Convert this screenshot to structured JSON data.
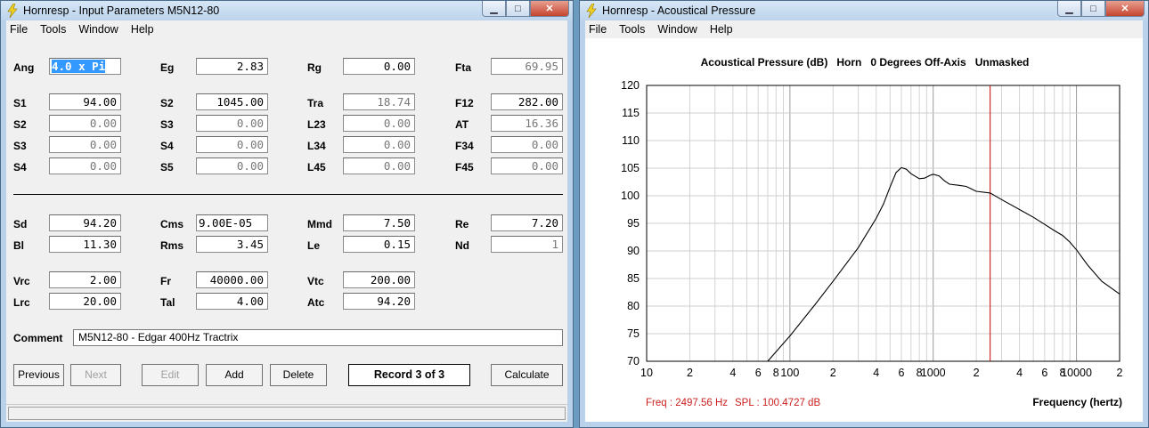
{
  "left_window": {
    "title": "Hornresp - Input Parameters   M5N12-80",
    "menu": [
      "File",
      "Tools",
      "Window",
      "Help"
    ],
    "fields": {
      "ang": {
        "label": "Ang",
        "value": "4.0 x Pi"
      },
      "eg": {
        "label": "Eg",
        "value": "2.83"
      },
      "rg": {
        "label": "Rg",
        "value": "0.00"
      },
      "fta": {
        "label": "Fta",
        "value": "69.95"
      },
      "s1": {
        "label": "S1",
        "value": "94.00"
      },
      "s2_top": {
        "label": "S2",
        "value": "1045.00"
      },
      "tra": {
        "label": "Tra",
        "value": "18.74"
      },
      "f12": {
        "label": "F12",
        "value": "282.00"
      },
      "s2": {
        "label": "S2",
        "value": "0.00"
      },
      "s3_mid": {
        "label": "S3",
        "value": "0.00"
      },
      "l23": {
        "label": "L23",
        "value": "0.00"
      },
      "at": {
        "label": "AT",
        "value": "16.36"
      },
      "s3": {
        "label": "S3",
        "value": "0.00"
      },
      "s4_mid": {
        "label": "S4",
        "value": "0.00"
      },
      "l34": {
        "label": "L34",
        "value": "0.00"
      },
      "f34": {
        "label": "F34",
        "value": "0.00"
      },
      "s4": {
        "label": "S4",
        "value": "0.00"
      },
      "s5": {
        "label": "S5",
        "value": "0.00"
      },
      "l45": {
        "label": "L45",
        "value": "0.00"
      },
      "f45": {
        "label": "F45",
        "value": "0.00"
      },
      "sd": {
        "label": "Sd",
        "value": "94.20"
      },
      "cms": {
        "label": "Cms",
        "value": "9.00E-05"
      },
      "mmd": {
        "label": "Mmd",
        "value": "7.50"
      },
      "re": {
        "label": "Re",
        "value": "7.20"
      },
      "bl": {
        "label": "Bl",
        "value": "11.30"
      },
      "rms": {
        "label": "Rms",
        "value": "3.45"
      },
      "le": {
        "label": "Le",
        "value": "0.15"
      },
      "nd": {
        "label": "Nd",
        "value": "1"
      },
      "vrc": {
        "label": "Vrc",
        "value": "2.00"
      },
      "fr": {
        "label": "Fr",
        "value": "40000.00"
      },
      "vtc": {
        "label": "Vtc",
        "value": "200.00"
      },
      "lrc": {
        "label": "Lrc",
        "value": "20.00"
      },
      "tal": {
        "label": "Tal",
        "value": "4.00"
      },
      "atc": {
        "label": "Atc",
        "value": "94.20"
      }
    },
    "comment_label": "Comment",
    "comment_value": "M5N12-80 - Edgar 400Hz Tractrix",
    "buttons": {
      "previous": "Previous",
      "next": "Next",
      "edit": "Edit",
      "add": "Add",
      "delete": "Delete",
      "calculate": "Calculate"
    },
    "record": "Record 3 of 3"
  },
  "right_window": {
    "title": "Hornresp - Acoustical Pressure",
    "menu": [
      "File",
      "Tools",
      "Window",
      "Help"
    ]
  },
  "chart_data": {
    "type": "line",
    "title": "Acoustical Pressure (dB)   Horn   0 Degrees Off-Axis   Unmasked",
    "xlabel": "Frequency (hertz)",
    "ylabel": "",
    "x_scale": "log",
    "xlim": [
      10,
      20000
    ],
    "ylim": [
      70,
      120
    ],
    "y_ticks": [
      "120",
      "115",
      "110",
      "105",
      "100",
      "95",
      "90",
      "85",
      "80",
      "75",
      "70"
    ],
    "x_tick_labels": [
      {
        "x": 10,
        "label": "10"
      },
      {
        "x": 20,
        "label": "2"
      },
      {
        "x": 40,
        "label": "4"
      },
      {
        "x": 60,
        "label": "6"
      },
      {
        "x": 80,
        "label": "8"
      },
      {
        "x": 100,
        "label": "100"
      },
      {
        "x": 200,
        "label": "2"
      },
      {
        "x": 400,
        "label": "4"
      },
      {
        "x": 600,
        "label": "6"
      },
      {
        "x": 800,
        "label": "8"
      },
      {
        "x": 1000,
        "label": "1000"
      },
      {
        "x": 2000,
        "label": "2"
      },
      {
        "x": 4000,
        "label": "4"
      },
      {
        "x": 6000,
        "label": "6"
      },
      {
        "x": 8000,
        "label": "8"
      },
      {
        "x": 10000,
        "label": "10000"
      },
      {
        "x": 20000,
        "label": "2"
      }
    ],
    "grid": true,
    "series": [
      {
        "color": "#000000",
        "points": [
          [
            70,
            70
          ],
          [
            100,
            74.6
          ],
          [
            150,
            80.3
          ],
          [
            200,
            84.5
          ],
          [
            300,
            90.6
          ],
          [
            400,
            95.9
          ],
          [
            450,
            98.5
          ],
          [
            500,
            101.6
          ],
          [
            550,
            104.2
          ],
          [
            600,
            105.1
          ],
          [
            650,
            104.8
          ],
          [
            700,
            104.0
          ],
          [
            800,
            103.1
          ],
          [
            870,
            103.2
          ],
          [
            950,
            103.7
          ],
          [
            1000,
            103.9
          ],
          [
            1100,
            103.6
          ],
          [
            1200,
            102.7
          ],
          [
            1300,
            102.1
          ],
          [
            1500,
            101.9
          ],
          [
            1700,
            101.7
          ],
          [
            2000,
            100.8
          ],
          [
            2500,
            100.5
          ],
          [
            3000,
            99.3
          ],
          [
            4000,
            97.5
          ],
          [
            5000,
            96.1
          ],
          [
            6000,
            94.8
          ],
          [
            7000,
            93.7
          ],
          [
            8000,
            92.8
          ],
          [
            9000,
            91.6
          ],
          [
            10000,
            90.2
          ],
          [
            12000,
            87.4
          ],
          [
            15000,
            84.5
          ],
          [
            20000,
            82.2
          ]
        ]
      }
    ],
    "marker": {
      "x": 2497.56,
      "color": "#cc0000"
    },
    "readout": {
      "freq": "Freq : 2497.56 Hz",
      "spl": "SPL : 100.4727 dB",
      "color": "#cc2020"
    }
  }
}
